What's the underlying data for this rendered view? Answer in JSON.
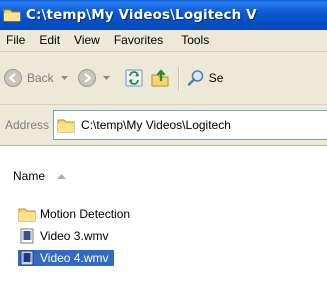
{
  "window": {
    "title": "C:\\temp\\My Videos\\Logitech V",
    "title_bar_color": "#0a56d0"
  },
  "menu": {
    "items": [
      "File",
      "Edit",
      "View",
      "Favorites",
      "Tools"
    ]
  },
  "toolbar": {
    "back_label": "Back",
    "back_icon": "back-arrow-icon",
    "forward_icon": "forward-arrow-icon",
    "up_icon": "up-folder-icon",
    "refresh_icon": "refresh-icon",
    "search_label": "Se",
    "search_icon": "search-icon"
  },
  "address": {
    "label": "Address",
    "value": "C:\\temp\\My Videos\\Logitech"
  },
  "list": {
    "column_header": "Name",
    "sort": "ascending",
    "selected_color": "#316ac5",
    "items": [
      {
        "name": "Motion Detection",
        "type": "folder",
        "selected": false
      },
      {
        "name": "Video 3.wmv",
        "type": "video-file",
        "selected": false
      },
      {
        "name": "Video 4.wmv",
        "type": "video-file",
        "selected": true
      }
    ]
  }
}
